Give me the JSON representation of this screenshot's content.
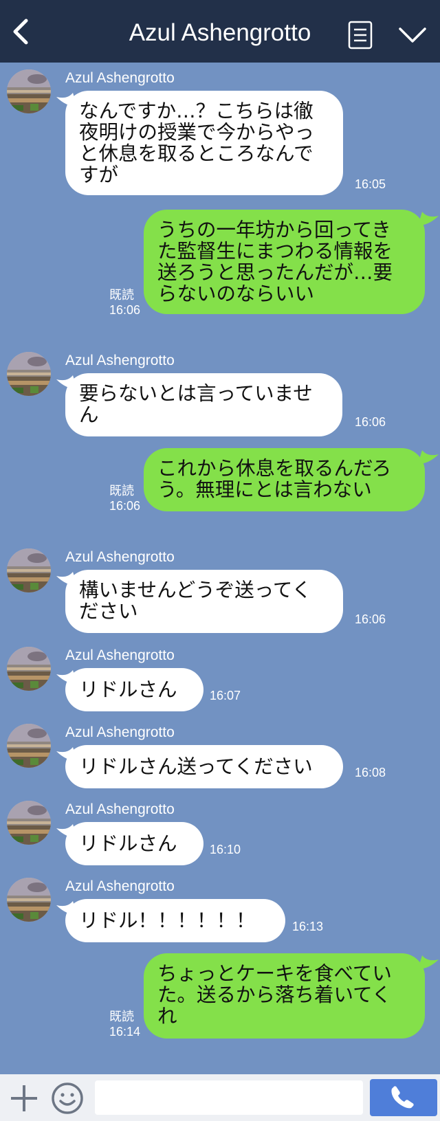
{
  "header": {
    "title": "Azul Ashengrotto",
    "back_icon": "back-chevron-icon",
    "menu_icon": "list-menu-icon",
    "collapse_icon": "chevron-down-icon"
  },
  "colors": {
    "background": "#7292c2",
    "header": "#223049",
    "incoming_bubble": "#ffffff",
    "outgoing_bubble": "#84e04a",
    "call_button": "#4f7ed9"
  },
  "messages": [
    {
      "direction": "incoming",
      "sender": "Azul Ashengrotto",
      "text": "なんですか…？こちらは徹\n夜明けの授業で今からやっ\nと休息を取るところなんで\nすが",
      "time": "16:05"
    },
    {
      "direction": "outgoing",
      "read": "既読",
      "text": "うちの一年坊から回ってき\nた監督生にまつわる情報を\n送ろうと思ったんだが…要\nらないのならいい",
      "time": "16:06"
    },
    {
      "direction": "incoming",
      "sender": "Azul Ashengrotto",
      "text": "要らないとは言っていませ\nん",
      "time": "16:06"
    },
    {
      "direction": "outgoing",
      "read": "既読",
      "text": "これから休息を取るんだろ\nう。無理にとは言わない",
      "time": "16:06"
    },
    {
      "direction": "incoming",
      "sender": "Azul Ashengrotto",
      "text": "構いませんどうぞ送ってく\nださい",
      "time": "16:06"
    },
    {
      "direction": "incoming",
      "sender": "Azul Ashengrotto",
      "text": "リドルさん",
      "time": "16:07"
    },
    {
      "direction": "incoming",
      "sender": "Azul Ashengrotto",
      "text": "リドルさん送ってください",
      "time": "16:08"
    },
    {
      "direction": "incoming",
      "sender": "Azul Ashengrotto",
      "text": "リドルさん",
      "time": "16:10"
    },
    {
      "direction": "incoming",
      "sender": "Azul Ashengrotto",
      "text": "リドル！！！！！！",
      "time": "16:13"
    },
    {
      "direction": "outgoing",
      "read": "既読",
      "text": "ちょっとケーキを食べてい\nた。送るから落ち着いてく\nれ",
      "time": "16:14"
    }
  ],
  "footer": {
    "plus_icon": "plus-icon",
    "emoji_icon": "smiley-icon",
    "input_value": "",
    "call_icon": "phone-icon"
  }
}
